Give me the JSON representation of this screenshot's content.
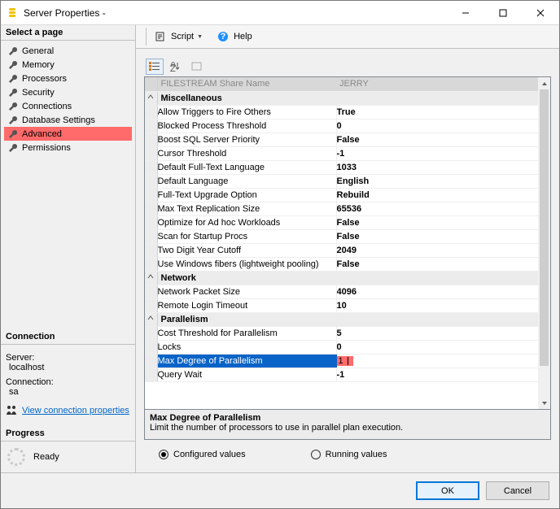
{
  "window": {
    "title": "Server Properties -"
  },
  "left": {
    "select_page": "Select a page",
    "pages": [
      "General",
      "Memory",
      "Processors",
      "Security",
      "Connections",
      "Database Settings",
      "Advanced",
      "Permissions"
    ],
    "selected": "Advanced",
    "connection_title": "Connection",
    "server_lbl": "Server:",
    "server_val": "localhost",
    "conn_lbl": "Connection:",
    "conn_val": "sa",
    "view_conn": "View connection properties",
    "progress_title": "Progress",
    "progress_status": "Ready"
  },
  "toolbar": {
    "script": "Script",
    "help": "Help"
  },
  "grid": {
    "columns": {
      "header_name": "FILESTREAM Share Name",
      "header_value": "JERRY"
    },
    "categories": [
      {
        "name": "Miscellaneous",
        "rows": [
          {
            "label": "Allow Triggers to Fire Others",
            "value": "True"
          },
          {
            "label": "Blocked Process Threshold",
            "value": "0"
          },
          {
            "label": "Boost SQL Server Priority",
            "value": "False"
          },
          {
            "label": "Cursor Threshold",
            "value": "-1"
          },
          {
            "label": "Default Full-Text Language",
            "value": "1033"
          },
          {
            "label": "Default Language",
            "value": "English"
          },
          {
            "label": "Full-Text Upgrade Option",
            "value": "Rebuild"
          },
          {
            "label": "Max Text Replication Size",
            "value": "65536"
          },
          {
            "label": "Optimize for Ad hoc Workloads",
            "value": "False"
          },
          {
            "label": "Scan for Startup Procs",
            "value": "False"
          },
          {
            "label": "Two Digit Year Cutoff",
            "value": "2049"
          },
          {
            "label": "Use Windows fibers (lightweight pooling)",
            "value": "False"
          }
        ]
      },
      {
        "name": "Network",
        "rows": [
          {
            "label": "Network Packet Size",
            "value": "4096"
          },
          {
            "label": "Remote Login Timeout",
            "value": "10"
          }
        ]
      },
      {
        "name": "Parallelism",
        "rows": [
          {
            "label": "Cost Threshold for Parallelism",
            "value": "5"
          },
          {
            "label": "Locks",
            "value": "0"
          },
          {
            "label": "Max Degree of Parallelism",
            "value": "1",
            "selected": true,
            "editing": true
          },
          {
            "label": "Query Wait",
            "value": "-1"
          }
        ]
      }
    ]
  },
  "help": {
    "title": "Max Degree of Parallelism",
    "desc": "Limit the number of processors to use in parallel plan execution."
  },
  "radios": {
    "configured": "Configured values",
    "running": "Running values"
  },
  "footer": {
    "ok": "OK",
    "cancel": "Cancel"
  }
}
